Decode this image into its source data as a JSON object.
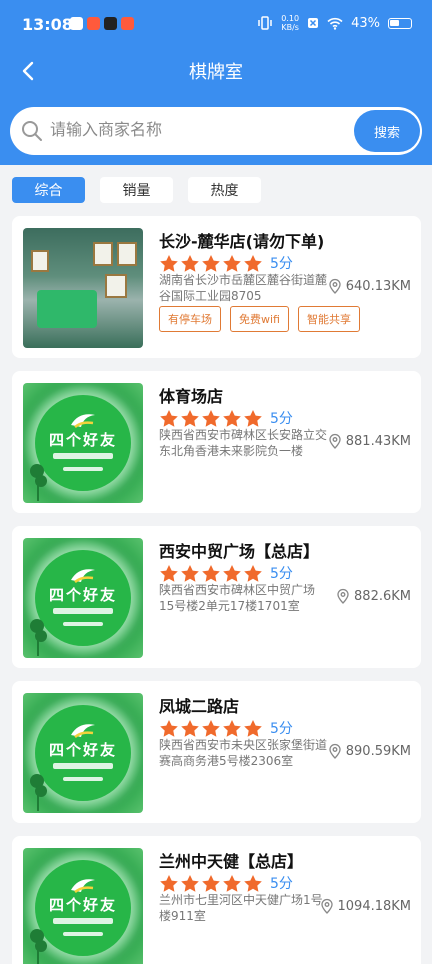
{
  "status_bar": {
    "time": "13:08",
    "net_speed": "0.10",
    "net_unit": "KB/s",
    "battery": "43%"
  },
  "nav": {
    "title": "棋牌室"
  },
  "search": {
    "placeholder": "请输入商家名称",
    "button": "搜索"
  },
  "tabs": [
    {
      "label": "综合",
      "active": true
    },
    {
      "label": "销量",
      "active": false
    },
    {
      "label": "热度",
      "active": false
    }
  ],
  "logo_text": "四个好友",
  "stores": [
    {
      "name": "长沙-麓华店(请勿下单)",
      "score": "5分",
      "rating": 5,
      "address": "湖南省长沙市岳麓区麓谷街道麓谷国际工业园8705",
      "distance": "640.13KM",
      "tags": [
        "有停车场",
        "免费wifi",
        "智能共享"
      ],
      "thumb": "room-photo"
    },
    {
      "name": "体育场店",
      "score": "5分",
      "rating": 5,
      "address": "陕西省西安市碑林区长安路立交东北角香港未来影院负一楼",
      "distance": "881.43KM",
      "tags": [],
      "thumb": "logo"
    },
    {
      "name": "西安中贸广场【总店】",
      "score": "5分",
      "rating": 5,
      "address": "陕西省西安市碑林区中贸广场15号楼2单元17楼1701室",
      "distance": "882.6KM",
      "tags": [],
      "thumb": "logo"
    },
    {
      "name": "凤城二路店",
      "score": "5分",
      "rating": 5,
      "address": "陕西省西安市未央区张家堡街道赛高商务港5号楼2306室",
      "distance": "890.59KM",
      "tags": [],
      "thumb": "logo"
    },
    {
      "name": "兰州中天健【总店】",
      "score": "5分",
      "rating": 5,
      "address": "兰州市七里河区中天健广场1号楼911室",
      "distance": "1094.18KM",
      "tags": [],
      "thumb": "logo"
    }
  ],
  "colors": {
    "primary": "#3a8ef0",
    "star": "#f06a2c",
    "tag": "#e07a35",
    "background": "#f2f3f5"
  }
}
